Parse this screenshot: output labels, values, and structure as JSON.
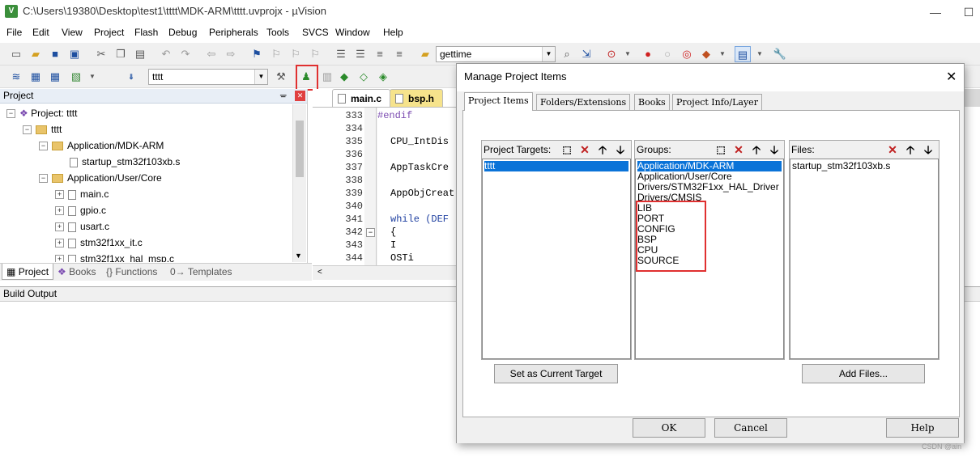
{
  "window": {
    "title": "C:\\Users\\19380\\Desktop\\test1\\tttt\\MDK-ARM\\tttt.uvprojx - µVision",
    "min_glyph": "—",
    "max_glyph": "☐"
  },
  "menu": [
    "File",
    "Edit",
    "View",
    "Project",
    "Flash",
    "Debug",
    "Peripherals",
    "Tools",
    "SVCS",
    "Window",
    "Help"
  ],
  "toolbar": {
    "find_combo": "gettime",
    "target_combo": "tttt"
  },
  "project_panel": {
    "header": "Project",
    "tree": [
      {
        "label": "Project: tttt",
        "kind": "root"
      },
      {
        "label": "tttt",
        "kind": "target"
      },
      {
        "label": "Application/MDK-ARM",
        "kind": "folder"
      },
      {
        "label": "startup_stm32f103xb.s",
        "kind": "file"
      },
      {
        "label": "Application/User/Core",
        "kind": "folder"
      },
      {
        "label": "main.c",
        "kind": "file"
      },
      {
        "label": "gpio.c",
        "kind": "file"
      },
      {
        "label": "usart.c",
        "kind": "file"
      },
      {
        "label": "stm32f1xx_it.c",
        "kind": "file"
      },
      {
        "label": "stm32f1xx_hal_msp.c",
        "kind": "file"
      }
    ],
    "tabs": [
      "Project",
      "Books",
      "Functions",
      "Templates"
    ]
  },
  "editor": {
    "tabs": [
      "main.c",
      "bsp.h"
    ],
    "lines": [
      {
        "no": "333",
        "code": "#endif"
      },
      {
        "no": "334",
        "code": ""
      },
      {
        "no": "335",
        "code": "CPU_IntDis"
      },
      {
        "no": "336",
        "code": ""
      },
      {
        "no": "337",
        "code": "AppTaskCre"
      },
      {
        "no": "338",
        "code": ""
      },
      {
        "no": "339",
        "code": "AppObjCreat"
      },
      {
        "no": "340",
        "code": ""
      },
      {
        "no": "341",
        "code": "while (DEF"
      },
      {
        "no": "342",
        "code": "{"
      },
      {
        "no": "343",
        "code": "        I"
      },
      {
        "no": "344",
        "code": "    OSTi"
      }
    ]
  },
  "build_output": {
    "header": "Build Output"
  },
  "dialog": {
    "title": "Manage Project Items",
    "tabs": [
      "Project Items",
      "Folders/Extensions",
      "Books",
      "Project Info/Layer"
    ],
    "targets": {
      "header": "Project Targets:",
      "items": [
        "tttt"
      ]
    },
    "groups": {
      "header": "Groups:",
      "items": [
        "Application/MDK-ARM",
        "Application/User/Core",
        "Drivers/STM32F1xx_HAL_Driver",
        "Drivers/CMSIS",
        "LIB",
        "PORT",
        "CONFIG",
        "BSP",
        "CPU",
        "SOURCE"
      ]
    },
    "files": {
      "header": "Files:",
      "items": [
        "startup_stm32f103xb.s"
      ]
    },
    "set_target_button": "Set as Current Target",
    "add_files_button": "Add Files...",
    "ok_button": "OK",
    "cancel_button": "Cancel",
    "help_button": "Help"
  },
  "watermark": "CSDN @ain",
  "colors": {
    "highlight_box": "#e03030",
    "selection": "#0a73d8"
  }
}
